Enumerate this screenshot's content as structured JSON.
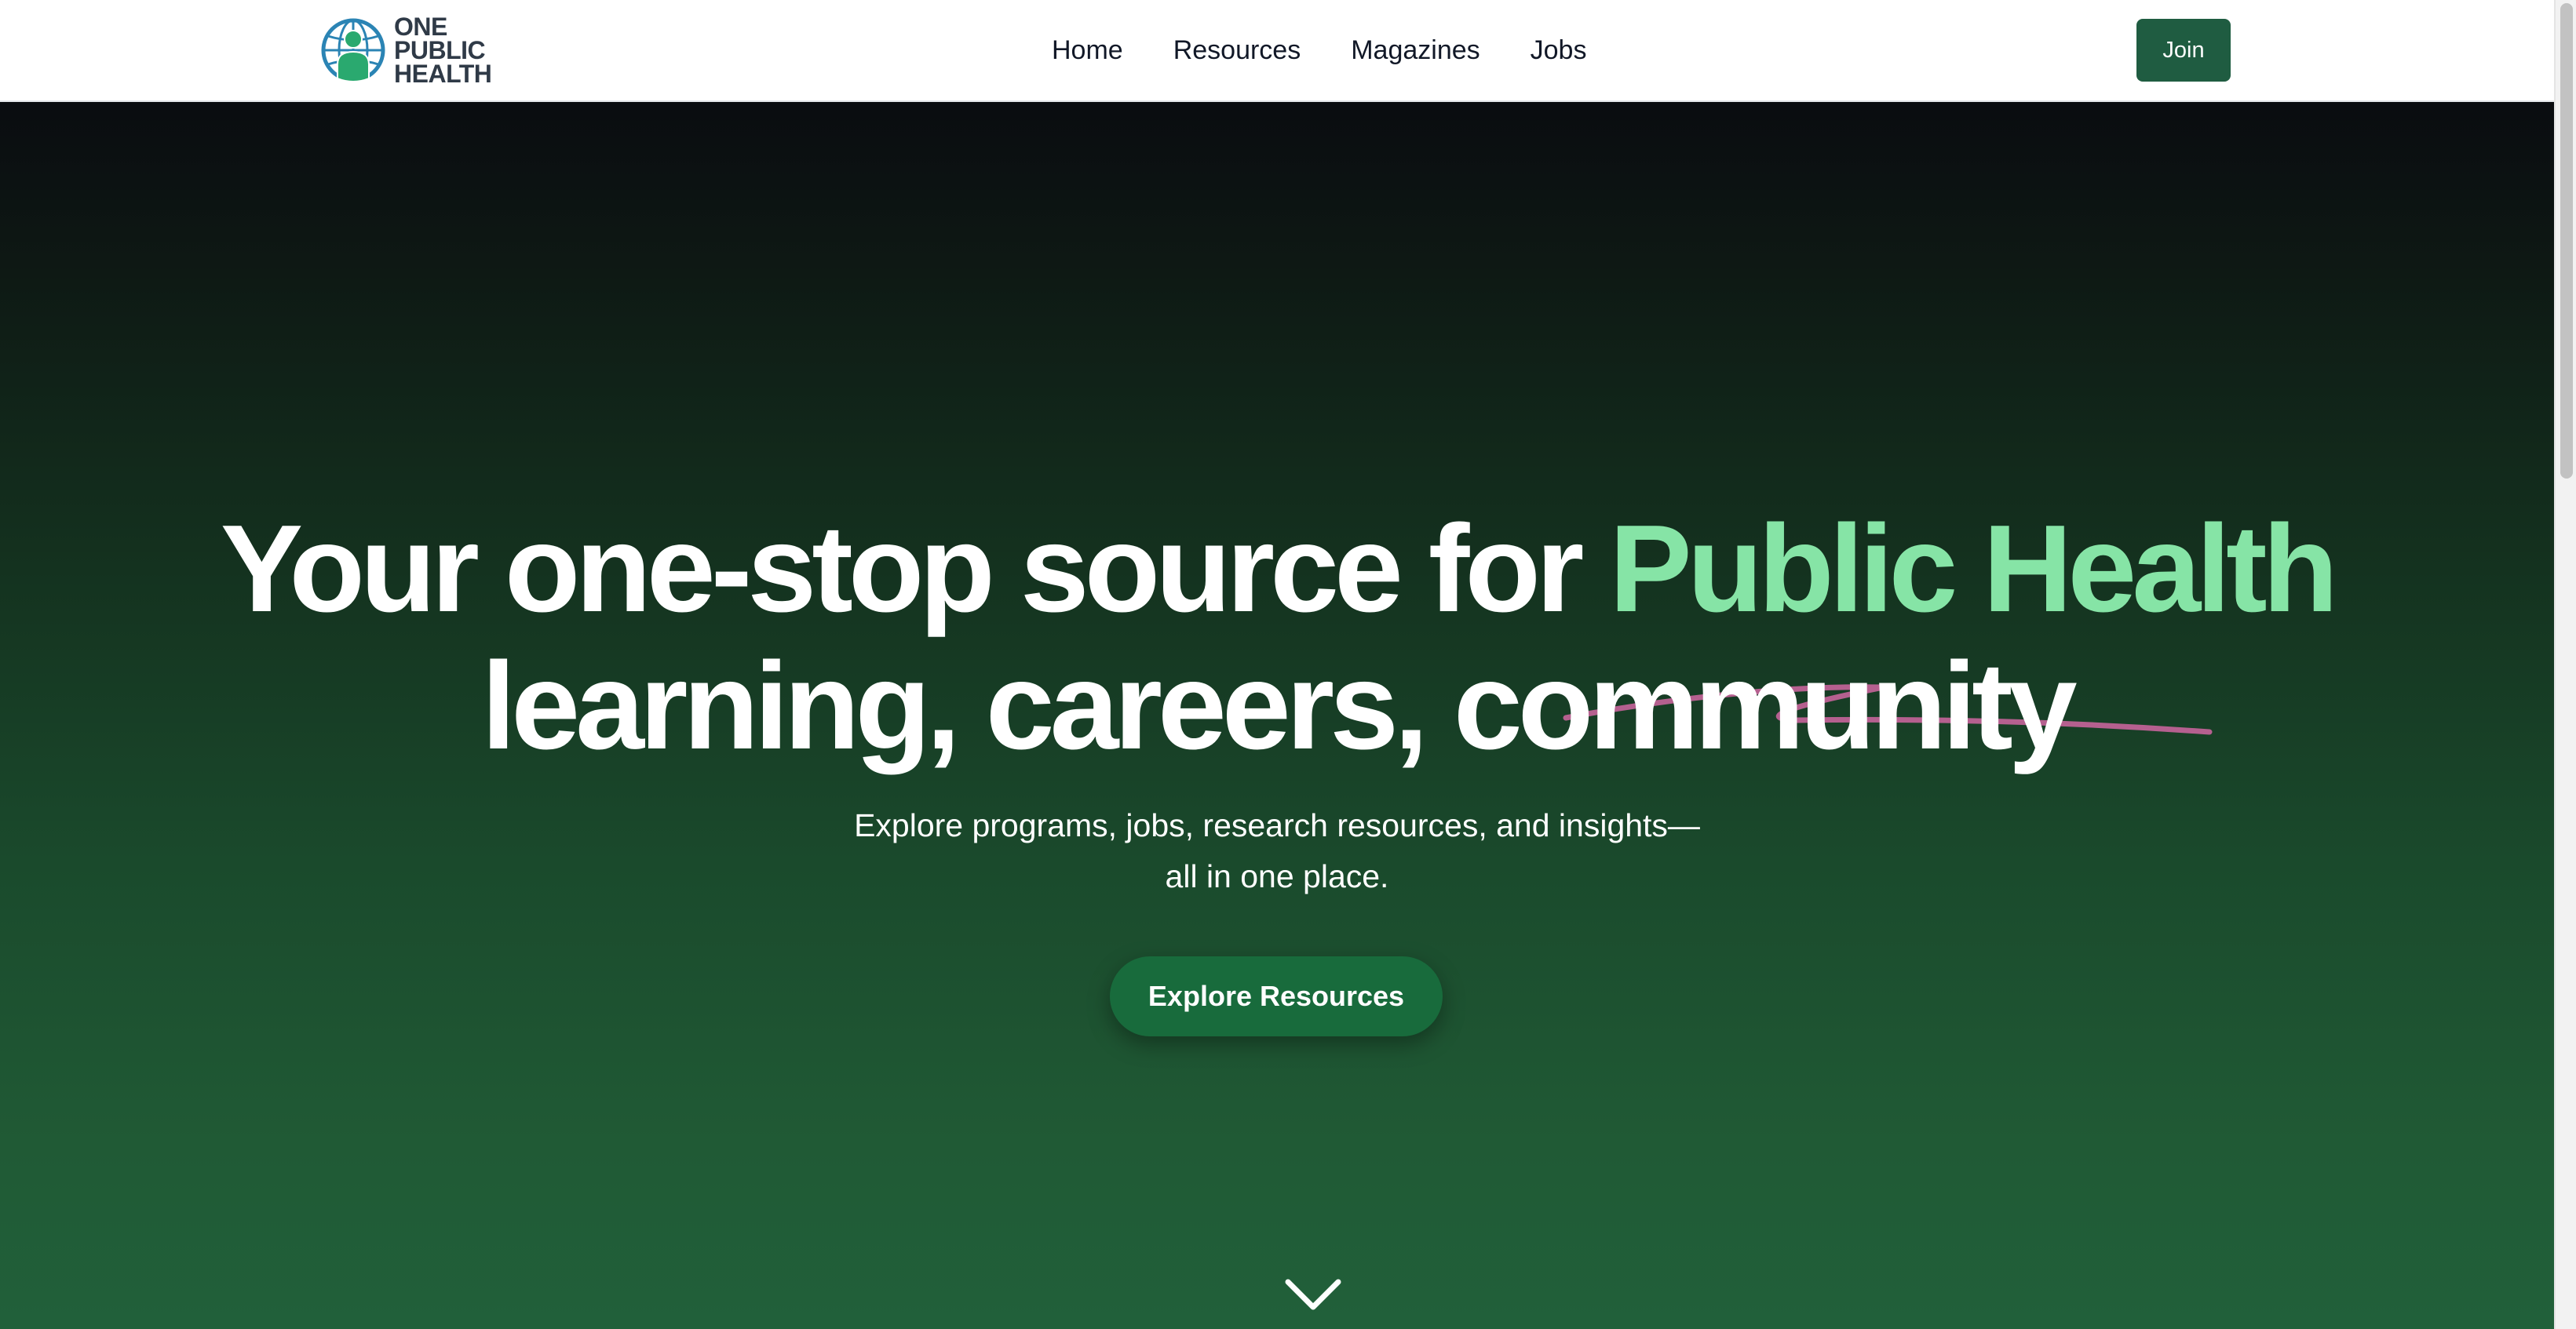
{
  "brand": {
    "line1": "ONE",
    "line2": "PUBLIC",
    "line3": "HEALTH",
    "logo_icon": "globe-person-icon"
  },
  "nav": {
    "links": [
      "Home",
      "Resources",
      "Magazines",
      "Jobs"
    ],
    "join_label": "Join"
  },
  "hero": {
    "headline_prefix": "Your one-stop source for ",
    "headline_accent": "Public Health",
    "headline_line2": "learning, careers, community",
    "subtext_line1": "Explore programs, jobs, research resources, and insights—",
    "subtext_line2": "all in one place.",
    "cta_label": "Explore Resources",
    "scroll_icon": "chevron-down-icon"
  },
  "colors": {
    "brand_green": "#1f5c41",
    "accent_green": "#86e4a6",
    "cta_green": "#186b3c",
    "squiggle_pink": "#b5608f",
    "logo_blue": "#2b84b4",
    "logo_green": "#2aa96f"
  }
}
